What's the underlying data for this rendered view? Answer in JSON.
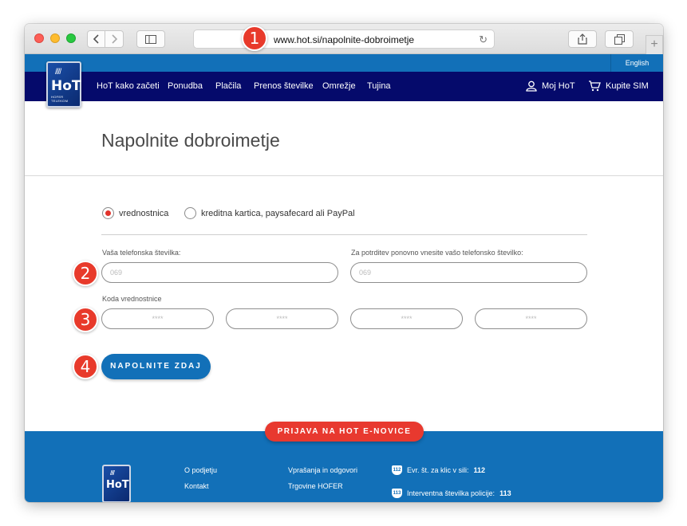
{
  "browser": {
    "url": "www.hot.si/napolnite-dobroimetje",
    "new_tab_label": "+"
  },
  "site": {
    "language_link": "English",
    "logo": {
      "text": "HoT",
      "subtitle": "HOFER TELEKOM"
    },
    "nav": [
      "HoT kako začeti",
      "Ponudba",
      "Plačila",
      "Prenos številke",
      "Omrežje",
      "Tujina"
    ],
    "account_label": "Moj HoT",
    "buy_sim_label": "Kupite SIM"
  },
  "page": {
    "title": "Napolnite dobroimetje",
    "payment_options": [
      {
        "label": "vrednostnica",
        "selected": true
      },
      {
        "label": "kreditna kartica, paysafecard ali PayPal",
        "selected": false
      }
    ],
    "phone_label": "Vaša telefonska številka:",
    "phone_placeholder": "069",
    "phone_confirm_label": "Za potrditev ponovno vnesite vašo telefonsko številko:",
    "phone_confirm_placeholder": "069",
    "voucher_label": "Koda vrednostnice",
    "voucher_placeholders": [
      "****",
      "****",
      "****",
      "****"
    ],
    "submit_label": "NAPOLNITE ZDAJ"
  },
  "footer": {
    "newsletter_label": "PRIJAVA NA HOT E-NOVICE",
    "col1": [
      "O podjetju",
      "Kontakt"
    ],
    "col2": [
      "Vprašanja in odgovori",
      "Trgovine HOFER"
    ],
    "emergency": [
      {
        "badge": "112",
        "text": "Evr. št. za klic v sili:",
        "number": "112"
      },
      {
        "badge": "113",
        "text": "Interventna številka policije:",
        "number": "113"
      }
    ]
  },
  "annotations": [
    "1",
    "2",
    "3",
    "4"
  ],
  "colors": {
    "brand_blue": "#1270b8",
    "nav_navy": "#050a6b",
    "accent_red": "#e8392f"
  }
}
